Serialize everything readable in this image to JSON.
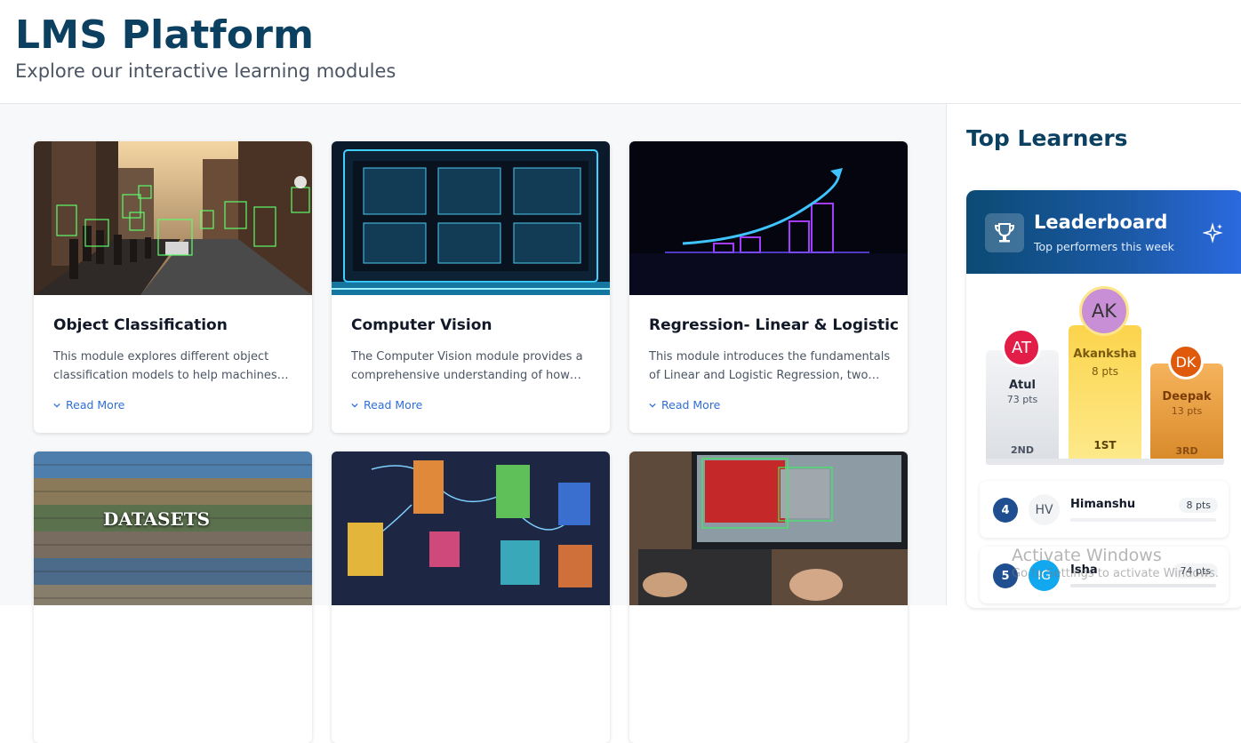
{
  "header": {
    "title": "LMS Platform",
    "subtitle": "Explore our interactive learning modules"
  },
  "modules": [
    {
      "title": "Object Classification",
      "description": "This module explores different object classification models to help machines…",
      "read_more": "Read More",
      "image": "city-street-detection"
    },
    {
      "title": "Computer Vision",
      "description": "The Computer Vision module provides a comprehensive understanding of how…",
      "read_more": "Read More",
      "image": "vision-monitor-screens"
    },
    {
      "title": "Regression- Linear & Logistic",
      "description": "This module introduces the fundamentals of Linear and Logistic Regression, two…",
      "read_more": "Read More",
      "image": "neon-growth-chart"
    },
    {
      "image": "datasets-collage",
      "image_text": "DATASETS"
    },
    {
      "image": "neural-network-blocks"
    },
    {
      "image": "car-detection-monitor"
    }
  ],
  "sidebar": {
    "title": "Top Learners",
    "leaderboard": {
      "title": "Leaderboard",
      "subtitle": "Top performers this week",
      "podium": [
        {
          "initials": "AT",
          "name": "Atul",
          "points": "73 pts",
          "rank": "2ND",
          "avatar_color": "#e11d48"
        },
        {
          "initials": "AK",
          "name": "Akanksha",
          "points": "8 pts",
          "rank": "1ST",
          "avatar_color": "#c98fd6"
        },
        {
          "initials": "DK",
          "name": "Deepak",
          "points": "13 pts",
          "rank": "3RD",
          "avatar_color": "#e05a0c"
        }
      ],
      "list": [
        {
          "rank": "4",
          "initials": "HV",
          "name": "Himanshu",
          "points": "8 pts",
          "avatar_color": "#f3f4f6"
        },
        {
          "rank": "5",
          "initials": "IG",
          "name": "Isha",
          "points": "74 pts",
          "avatar_color": "#11a8f0"
        }
      ]
    }
  },
  "watermark": {
    "line1": "Activate Windows",
    "line2": "Go to Settings to activate Windows."
  }
}
